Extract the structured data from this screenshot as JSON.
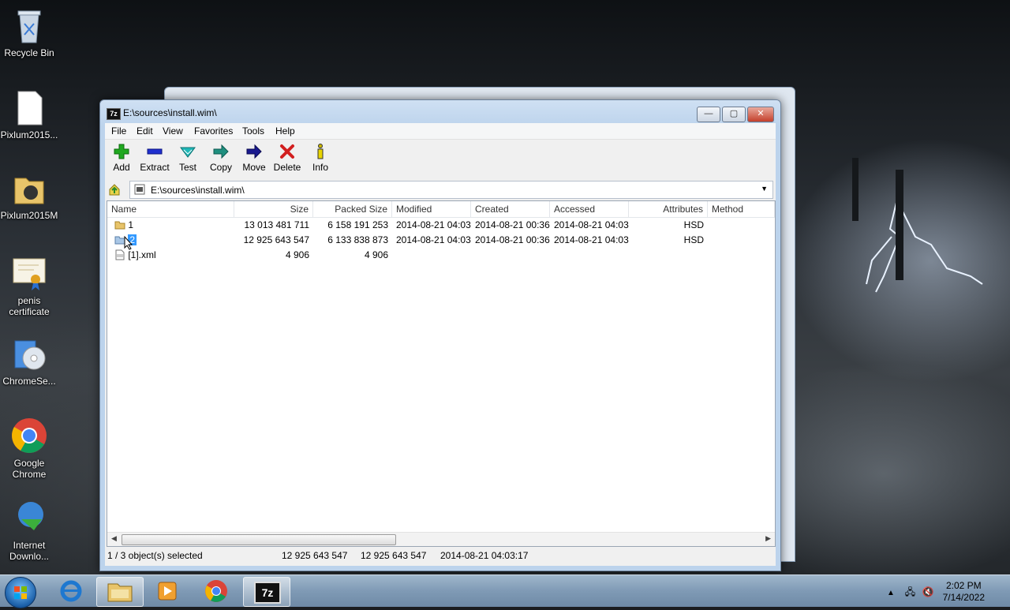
{
  "desktop": {
    "icons": [
      {
        "label": "Recycle Bin",
        "icon": "recycle-bin-icon"
      },
      {
        "label": "Pixlum2015...",
        "icon": "file-icon"
      },
      {
        "label": "Pixlum2015M",
        "icon": "folder-icon"
      },
      {
        "label": "penis certificate",
        "icon": "certificate-icon"
      },
      {
        "label": "ChromeSe...",
        "icon": "installer-icon"
      },
      {
        "label": "Google Chrome",
        "icon": "chrome-icon"
      },
      {
        "label": "Internet Downlo...",
        "icon": "idm-icon"
      }
    ]
  },
  "window": {
    "title": "E:\\sources\\install.wim\\",
    "app_icon_text": "7z",
    "controls": {
      "minimize": "—",
      "maximize": "▢",
      "close": "✕"
    },
    "menu": [
      "File",
      "Edit",
      "View",
      "Favorites",
      "Tools",
      "Help"
    ],
    "toolbar": [
      {
        "label": "Add",
        "icon": "add-icon",
        "color": "#1fa81f"
      },
      {
        "label": "Extract",
        "icon": "extract-icon",
        "color": "#1f2fcf"
      },
      {
        "label": "Test",
        "icon": "test-icon",
        "color": "#1fb8b8"
      },
      {
        "label": "Copy",
        "icon": "copy-icon",
        "color": "#1f8f7f"
      },
      {
        "label": "Move",
        "icon": "move-icon",
        "color": "#1a1a8f"
      },
      {
        "label": "Delete",
        "icon": "delete-icon",
        "color": "#d21f1f"
      },
      {
        "label": "Info",
        "icon": "info-icon",
        "color": "#c8b400"
      }
    ],
    "address": "E:\\sources\\install.wim\\",
    "columns": [
      "Name",
      "Size",
      "Packed Size",
      "Modified",
      "Created",
      "Accessed",
      "Attributes",
      "Method"
    ],
    "rows": [
      {
        "name": "1",
        "size": "13 013 481 711",
        "packed": "6 158 191 253",
        "modified": "2014-08-21 04:03",
        "created": "2014-08-21 00:36",
        "accessed": "2014-08-21 04:03",
        "attributes": "HSD",
        "method": "",
        "icon": "folder-icon",
        "selected": false
      },
      {
        "name": "2",
        "size": "12 925 643 547",
        "packed": "6 133 838 873",
        "modified": "2014-08-21 04:03",
        "created": "2014-08-21 00:36",
        "accessed": "2014-08-21 04:03",
        "attributes": "HSD",
        "method": "",
        "icon": "folder-icon",
        "selected": true
      },
      {
        "name": "[1].xml",
        "size": "4 906",
        "packed": "4 906",
        "modified": "",
        "created": "",
        "accessed": "",
        "attributes": "",
        "method": "",
        "icon": "xml-file-icon",
        "selected": false
      }
    ],
    "status": {
      "selection": "1 / 3 object(s) selected",
      "size": "12 925 643 547",
      "packed": "12 925 643 547",
      "modified": "2014-08-21 04:03:17"
    }
  },
  "taskbar": {
    "items": [
      "start-button",
      "internet-explorer",
      "windows-explorer",
      "media-player",
      "google-chrome",
      "7-zip"
    ],
    "clock_time": "2:02 PM",
    "clock_date": "7/14/2022"
  }
}
